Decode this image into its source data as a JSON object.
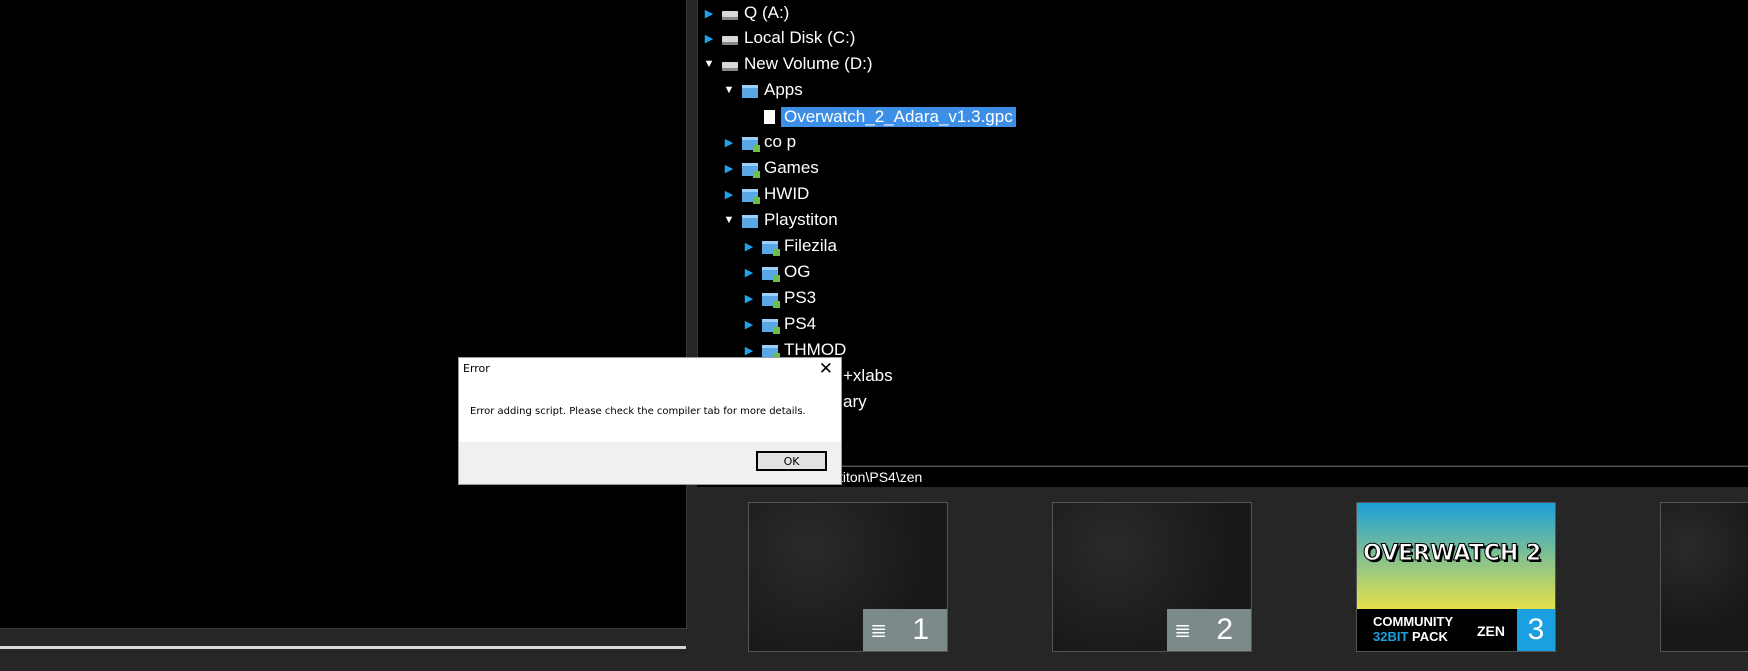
{
  "tree": {
    "drives": [
      {
        "label": "Q (A:)",
        "expanded": false
      },
      {
        "label": "Local Disk (C:)",
        "expanded": false
      },
      {
        "label": "New Volume (D:)",
        "expanded": true
      }
    ],
    "folders": {
      "apps": "Apps",
      "apps_file": "Overwatch_2_Adara_v1.3.gpc",
      "co_p": "co p",
      "games": "Games",
      "hwid": "HWID",
      "playstiton": "Playstiton",
      "filezila": "Filezila",
      "og": "OG",
      "ps3": "PS3",
      "ps4": "PS4",
      "thmod": "THMOD",
      "xlabs_partial": "+xlabs",
      "ary_partial": "ary"
    }
  },
  "path_bar": {
    "text": "stiton\\PS4\\zen"
  },
  "slots": [
    {
      "number": "1",
      "lines_icon": "≣"
    },
    {
      "number": "2",
      "lines_icon": "≣"
    },
    {
      "number": "3",
      "title": "OVERWATCH 2",
      "community": "COMMUNITY",
      "pack_highlight": "32BIT",
      "pack": "PACK",
      "zen": "ZEN"
    }
  ],
  "dialog": {
    "title": "Error",
    "close": "✕",
    "message": "Error adding script. Please check the compiler tab for more details.",
    "ok_label": "OK"
  },
  "colors": {
    "accent": "#1aa0e0",
    "selection": "#3d8ee6",
    "background": "#262626"
  }
}
